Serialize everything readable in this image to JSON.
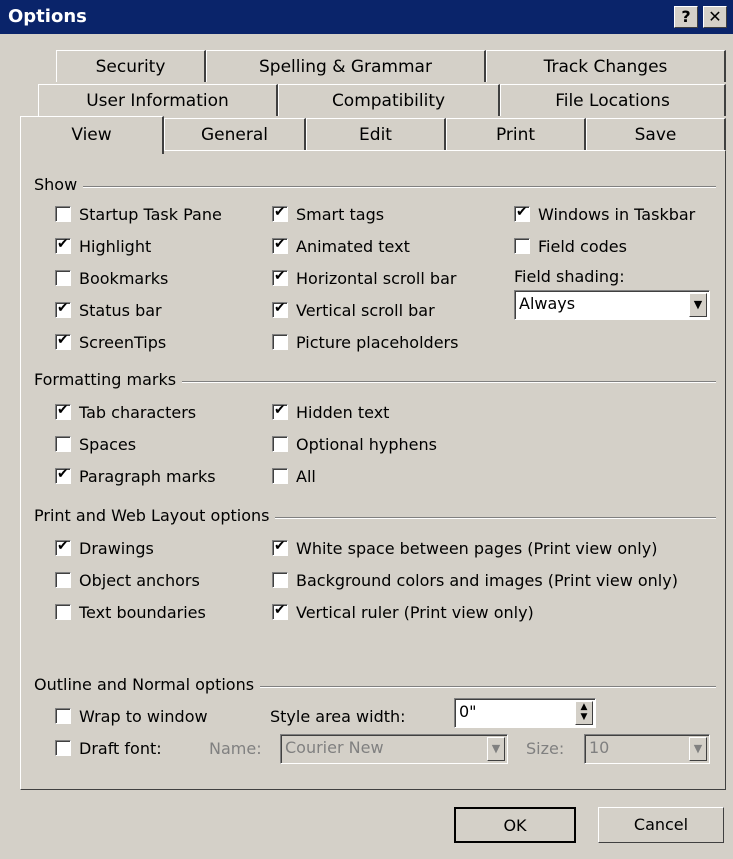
{
  "window": {
    "title": "Options",
    "help_icon": "question-mark",
    "close_icon": "x"
  },
  "tabs": {
    "row1": [
      "Security",
      "Spelling & Grammar",
      "Track Changes"
    ],
    "row2": [
      "User Information",
      "Compatibility",
      "File Locations"
    ],
    "row3": [
      "View",
      "General",
      "Edit",
      "Print",
      "Save"
    ],
    "active": "View"
  },
  "show": {
    "heading": "Show",
    "startup_task_pane": "Startup Task Pane",
    "highlight": "Highlight",
    "bookmarks": "Bookmarks",
    "status_bar": "Status bar",
    "screentips": "ScreenTips",
    "smart_tags": "Smart tags",
    "animated_text": "Animated text",
    "horizontal_scroll_bar": "Horizontal scroll bar",
    "vertical_scroll_bar": "Vertical scroll bar",
    "picture_placeholders": "Picture placeholders",
    "windows_in_taskbar": "Windows in Taskbar",
    "field_codes": "Field codes",
    "field_shading_label": "Field shading:",
    "field_shading_value": "Always"
  },
  "formatting": {
    "heading": "Formatting marks",
    "tab_characters": "Tab characters",
    "spaces": "Spaces",
    "paragraph_marks": "Paragraph marks",
    "hidden_text": "Hidden text",
    "optional_hyphens": "Optional hyphens",
    "all": "All"
  },
  "print_web": {
    "heading": "Print and Web Layout options",
    "drawings": "Drawings",
    "object_anchors": "Object anchors",
    "text_boundaries": "Text boundaries",
    "white_space": "White space between pages (Print view only)",
    "background_colors": "Background colors and images (Print view only)",
    "vertical_ruler": "Vertical ruler (Print view only)"
  },
  "outline": {
    "heading": "Outline and Normal options",
    "wrap_to_window": "Wrap to window",
    "draft_font": "Draft font:",
    "style_area_width_label": "Style area width:",
    "style_area_width_value": "0\"",
    "name_label": "Name:",
    "name_value": "Courier New",
    "size_label": "Size:",
    "size_value": "10"
  },
  "buttons": {
    "ok": "OK",
    "cancel": "Cancel"
  }
}
